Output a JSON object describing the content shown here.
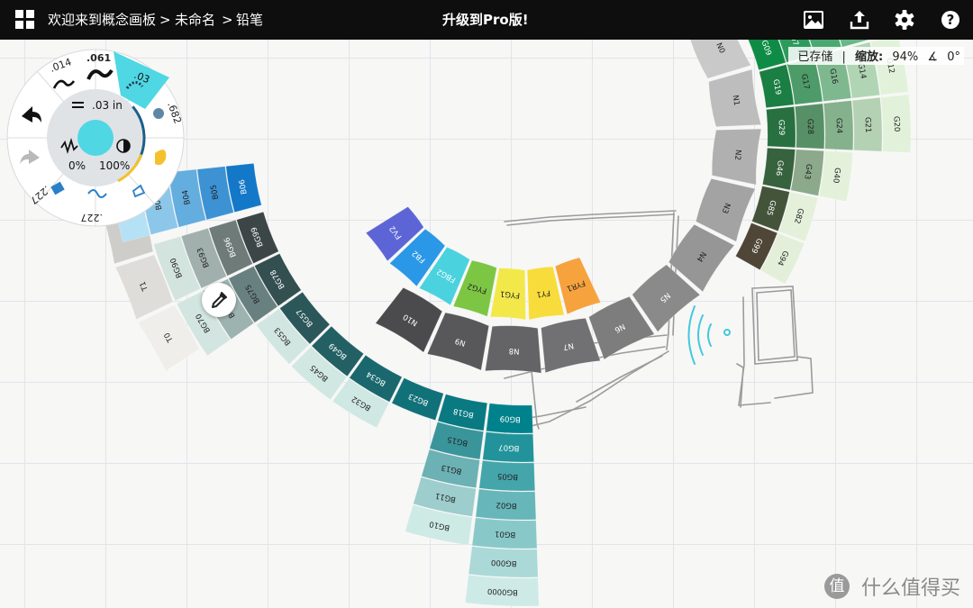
{
  "header": {
    "breadcrumb": [
      "欢迎来到概念画板",
      ">",
      "未命名",
      ">",
      "铅笔"
    ],
    "upgrade_label": "升级到Pro版!",
    "icons": [
      "grid-menu-icon",
      "gallery-icon",
      "export-icon",
      "settings-gear-icon",
      "help-icon"
    ]
  },
  "status": {
    "saved": "已存储",
    "separator": "|",
    "zoom_label": "缩放:",
    "zoom_value": "94%",
    "angle_icon": "angle-icon",
    "angle_value": "0°"
  },
  "tool_wheel": {
    "size_a": ".014",
    "size_b": ".061",
    "size_c": ".03",
    "size_d": ".682",
    "size_e": ".227",
    "size_f": ".227",
    "width_display": ".03 in",
    "smoothing": "0%",
    "opacity": "100%",
    "brush_color": "#4fd7e4",
    "icons": [
      "undo-icon",
      "redo-icon",
      "width-icon",
      "smoothing-icon",
      "opacity-icon",
      "pencil-tool-icon",
      "airbrush-tool-icon",
      "highlighter-tool-icon",
      "eraser-tool-icon",
      "selection-tool-icon",
      "brush-tool-icon"
    ]
  },
  "color_wheel": {
    "inner_ring": [
      {
        "label": "FV2",
        "color": "#5d65d6"
      },
      {
        "label": "FB2",
        "color": "#2a98e6"
      },
      {
        "label": "FBG2",
        "color": "#4ad2de"
      },
      {
        "label": "FYG2",
        "color": "#7cc644"
      },
      {
        "label": "FYG1",
        "color": "#f2e84a"
      },
      {
        "label": "FY1",
        "color": "#f8dc3c"
      },
      {
        "label": "FYR1",
        "color": "#f6a33e"
      }
    ],
    "warm_grey_ring": [
      "T3",
      "T2",
      "T1",
      "T0"
    ],
    "neutral_ring": [
      "N10",
      "N9",
      "N8",
      "N7",
      "N6",
      "N5",
      "N4",
      "N3",
      "N2",
      "N1",
      "N0",
      "C10"
    ],
    "yellow_rows": [
      {
        "labels": [
          "Y38",
          "Y35",
          "Y32"
        ]
      },
      {
        "labels": [
          "Y28",
          "Y26",
          "Y23",
          "Y21"
        ]
      }
    ],
    "yellow_green_rows": [
      {
        "labels": [
          "YG09",
          "YG07",
          "YG06",
          "YG05",
          "YG03",
          "YG01",
          "YG00",
          "YG0000"
        ]
      },
      {
        "labels": [
          "YG17",
          "YG13",
          "YG11"
        ]
      },
      {
        "labels": [
          "YG25",
          "YG23",
          "YG21"
        ]
      },
      {
        "labels": [
          "YG45",
          "YG41"
        ]
      },
      {
        "labels": [
          "YG67",
          "YG63",
          "YG61"
        ]
      },
      {
        "labels": [
          "YG99",
          "YG97",
          "YG95",
          "YG93",
          "YG91"
        ]
      }
    ],
    "green_rows": [
      {
        "labels": [
          "G09",
          "G07",
          "G05",
          "G03",
          "G02",
          "G00",
          "G000",
          "G0000"
        ]
      },
      {
        "labels": [
          "G19",
          "G17",
          "G16",
          "G14",
          "G12"
        ]
      },
      {
        "labels": [
          "G29",
          "G28",
          "G24",
          "G21",
          "G20"
        ]
      },
      {
        "labels": [
          "G46",
          "G43",
          "G40"
        ]
      },
      {
        "labels": [
          "G85",
          "G82"
        ]
      },
      {
        "labels": [
          "G99",
          "G94"
        ]
      }
    ],
    "blue_green_rows": [
      {
        "labels": [
          "BG09",
          "BG07",
          "BG05",
          "BG02",
          "BG01",
          "BG000",
          "BG0000"
        ]
      },
      {
        "labels": [
          "BG18",
          "BG15",
          "BG13",
          "BG11",
          "BG10"
        ]
      },
      {
        "labels": [
          "BG23"
        ]
      },
      {
        "labels": [
          "BG34",
          "BG32"
        ]
      },
      {
        "labels": [
          "BG49",
          "BG45"
        ]
      },
      {
        "labels": [
          "BG57",
          "BG53"
        ]
      },
      {
        "labels": [
          "BG78",
          "BG75",
          "BG72",
          "BG70"
        ]
      },
      {
        "labels": [
          "BG99",
          "BG96",
          "BG93",
          "BG90"
        ]
      }
    ],
    "blue_rows": [
      {
        "labels": [
          "B06",
          "B05",
          "B04",
          "B02",
          "B01"
        ]
      }
    ]
  },
  "watermark": {
    "badge": "值",
    "text": "什么值得买"
  }
}
